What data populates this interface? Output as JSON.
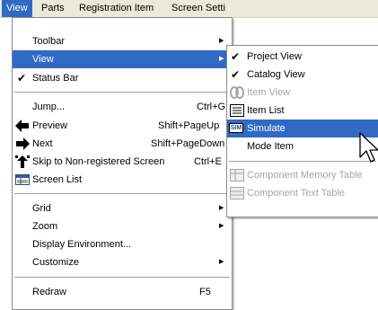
{
  "menubar": {
    "items": [
      {
        "label": "View",
        "active": true
      },
      {
        "label": "Parts"
      },
      {
        "label": "Registration Item"
      },
      {
        "label": "Screen Setti"
      }
    ]
  },
  "main_menu": {
    "groups": [
      [
        {
          "label": "Toolbar",
          "submenu": true
        },
        {
          "label": "View",
          "submenu": true,
          "highlighted": true
        },
        {
          "label": "Status Bar",
          "checked": true
        }
      ],
      [
        {
          "label": "Jump...",
          "shortcut": "Ctrl+G"
        },
        {
          "label": "Preview",
          "shortcut": "Shift+PageUp",
          "icon": "arrow-left-icon"
        },
        {
          "label": "Next",
          "shortcut": "Shift+PageDown",
          "icon": "arrow-right-icon"
        },
        {
          "label": "Skip to Non-registered Screen",
          "shortcut": "Ctrl+E",
          "icon": "skip-icon"
        },
        {
          "label": "Screen List",
          "icon": "screen-list-icon"
        }
      ],
      [
        {
          "label": "Grid",
          "submenu": true
        },
        {
          "label": "Zoom",
          "submenu": true
        },
        {
          "label": "Display Environment..."
        },
        {
          "label": "Customize",
          "submenu": true
        }
      ],
      [
        {
          "label": "Redraw",
          "shortcut": "F5"
        }
      ]
    ]
  },
  "view_submenu": {
    "groups": [
      [
        {
          "label": "Project View",
          "checked": true
        },
        {
          "label": "Catalog View",
          "checked": true
        },
        {
          "label": "Item View",
          "disabled": true,
          "icon": "item-view-icon"
        },
        {
          "label": "Item List",
          "icon": "item-list-icon"
        },
        {
          "label": "Simulate",
          "highlighted": true,
          "icon": "simulate-icon",
          "icon_text": "SIM"
        },
        {
          "label": "Mode Item"
        }
      ],
      [
        {
          "label": "Component Memory Table",
          "disabled": true,
          "icon": "memory-table-icon"
        },
        {
          "label": "Component Text Table",
          "disabled": true,
          "icon": "text-table-icon"
        }
      ]
    ]
  },
  "colors": {
    "highlight": "#316ac5",
    "menubar": "#ece9d8",
    "disabled": "#a5a5a5"
  }
}
